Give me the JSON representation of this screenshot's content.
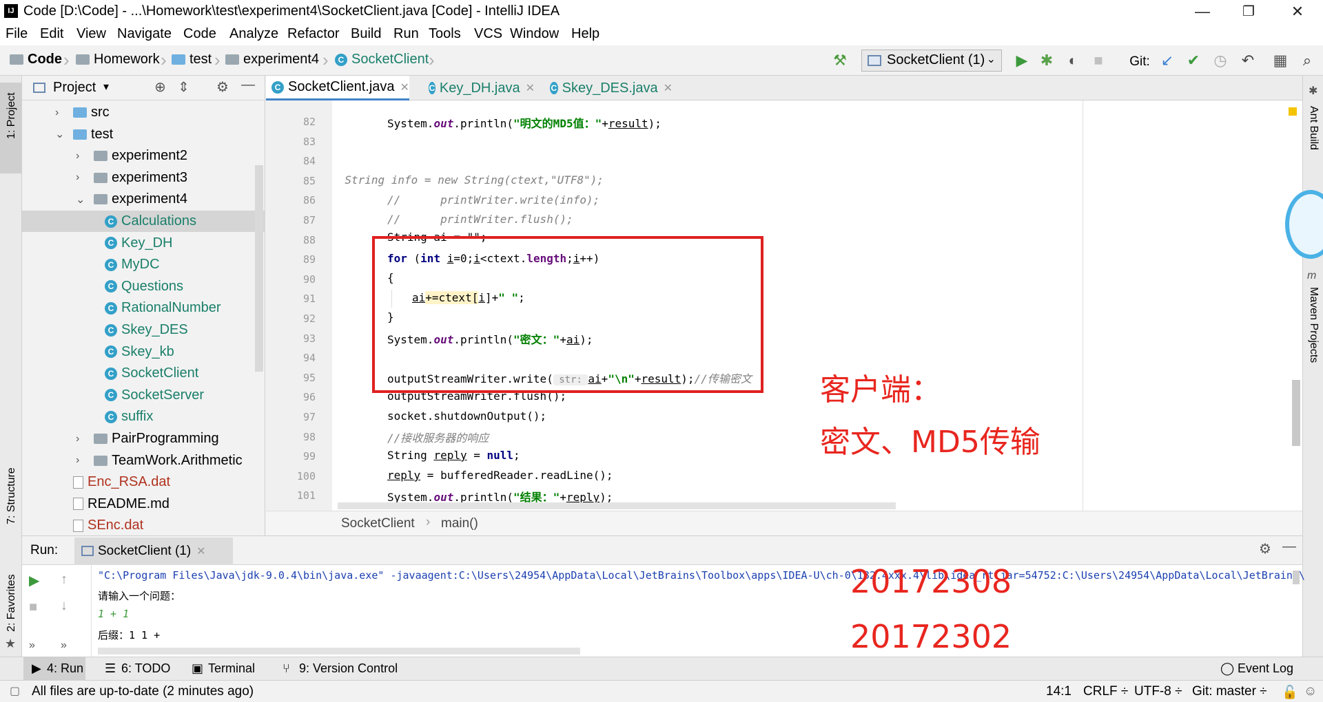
{
  "window": {
    "title": "Code [D:\\Code] - ...\\Homework\\test\\experiment4\\SocketClient.java [Code] - IntelliJ IDEA",
    "app_icon": "IJ",
    "minimize": "—",
    "restore": "❐",
    "close": "✕"
  },
  "menu": [
    "File",
    "Edit",
    "View",
    "Navigate",
    "Code",
    "Analyze",
    "Refactor",
    "Build",
    "Run",
    "Tools",
    "VCS",
    "Window",
    "Help"
  ],
  "navbar": {
    "crumbs": [
      "Code",
      "Homework",
      "test",
      "experiment4",
      "SocketClient"
    ],
    "run_config": "SocketClient (1)",
    "git_label": "Git:"
  },
  "left_stripe": {
    "project_tab": "1: Project",
    "structure_tab": "7: Structure",
    "favorites_tab": "2: Favorites"
  },
  "project_panel": {
    "title": "Project",
    "tree": [
      {
        "label": "src",
        "kind": "folder-blue",
        "arrow": "›"
      },
      {
        "label": "test",
        "kind": "folder-blue",
        "arrow": "⌄"
      },
      {
        "label": "experiment2",
        "kind": "folder",
        "arrow": "›"
      },
      {
        "label": "experiment3",
        "kind": "folder",
        "arrow": "›"
      },
      {
        "label": "experiment4",
        "kind": "folder",
        "arrow": "⌄"
      },
      {
        "label": "Calculations",
        "kind": "class"
      },
      {
        "label": "Key_DH",
        "kind": "class"
      },
      {
        "label": "MyDC",
        "kind": "class"
      },
      {
        "label": "Questions",
        "kind": "class"
      },
      {
        "label": "RationalNumber",
        "kind": "class"
      },
      {
        "label": "Skey_DES",
        "kind": "class"
      },
      {
        "label": "Skey_kb",
        "kind": "class"
      },
      {
        "label": "SocketClient",
        "kind": "class"
      },
      {
        "label": "SocketServer",
        "kind": "class"
      },
      {
        "label": "suffix",
        "kind": "class"
      },
      {
        "label": "PairProgramming",
        "kind": "folder",
        "arrow": "›"
      },
      {
        "label": "TeamWork.Arithmetic",
        "kind": "folder",
        "arrow": "›"
      },
      {
        "label": "Enc_RSA.dat",
        "kind": "file-red"
      },
      {
        "label": "README.md",
        "kind": "file-md"
      },
      {
        "label": "SEnc.dat",
        "kind": "file-red"
      }
    ]
  },
  "editor": {
    "tabs": [
      {
        "label": "SocketClient.java",
        "active": true
      },
      {
        "label": "Key_DH.java",
        "active": false
      },
      {
        "label": "Skey_DES.java",
        "active": false
      }
    ],
    "line_numbers": [
      "82",
      "83",
      "84",
      "85",
      "86",
      "87",
      "88",
      "89",
      "90",
      "91",
      "92",
      "93",
      "94",
      "95",
      "96",
      "97",
      "98",
      "99",
      "100",
      "101"
    ],
    "breadcrumb": [
      "SocketClient",
      "main()"
    ],
    "lines": {
      "l82": [
        "System.",
        "out",
        ".println(",
        "\"明文的MD5值：\"",
        "+",
        "result",
        ");"
      ],
      "l85": "//        String info = new String(ctext,\"UTF8\");",
      "l86": "//      printWriter.write(info);",
      "l87": "//      printWriter.flush();",
      "l88": "String ai = \"\";",
      "l89": [
        "for",
        " (",
        "int",
        " ",
        "i",
        "=0;",
        "i",
        "<ctext.",
        "length",
        ";",
        "i",
        "++)"
      ],
      "l90": "{",
      "l91": [
        "ai",
        "+=ctext[",
        "i",
        "]+",
        "\" \"",
        ";"
      ],
      "l92": "}",
      "l93": [
        "System.",
        "out",
        ".println(",
        "\"密文：\"",
        "+",
        "ai",
        ");"
      ],
      "l95": [
        "outputStreamWriter.write(",
        " str: ",
        "ai",
        "+",
        "\"\\n\"",
        "+",
        "result",
        ");",
        "//传输密文"
      ],
      "l96": "outputStreamWriter.flush();",
      "l97": "socket.shutdownOutput();",
      "l98": "//接收服务器的响应",
      "l99": [
        "String ",
        "reply",
        " = ",
        "null",
        ";"
      ],
      "l100": [
        "reply",
        " = bufferedReader.readLine();"
      ],
      "l101": [
        "System.",
        "out",
        ".println(",
        "\"结果：\"",
        "+",
        "reply",
        ");"
      ]
    }
  },
  "annotations": {
    "client_label": "客户端：",
    "client_sub": "密文、MD5传输",
    "id1": "20172308",
    "id2": "20172302"
  },
  "right_stripe": {
    "ant": "Ant Build",
    "maven": "Maven Projects"
  },
  "run_panel": {
    "label": "Run:",
    "tab": "SocketClient (1)",
    "output": [
      "\"C:\\Program Files\\Java\\jdk-9.0.4\\bin\\java.exe\" -javaagent:C:\\Users\\24954\\AppData\\Local\\JetBrains\\Toolbox\\apps\\IDEA-U\\ch-0\\182.4xxx.4\\lib\\idea_rt.jar=54752:C:\\Users\\24954\\AppData\\Local\\JetBrains\\",
      "请输入一个问题：",
      "1 + 1",
      "后缀：1 1 +"
    ]
  },
  "tool_windows": [
    "4: Run",
    "6: TODO",
    "Terminal",
    "9: Version Control",
    "Event Log"
  ],
  "status": {
    "message": "All files are up-to-date (2 minutes ago)",
    "position": "14:1",
    "line_sep": "CRLF ÷",
    "encoding": "UTF-8 ÷",
    "git": "Git: master ÷"
  },
  "colors": {
    "accent": "#4083c9",
    "annotation_red": "#e8261f",
    "keyword": "#000080",
    "string": "#008000",
    "class_icon": "#33a0c8"
  }
}
